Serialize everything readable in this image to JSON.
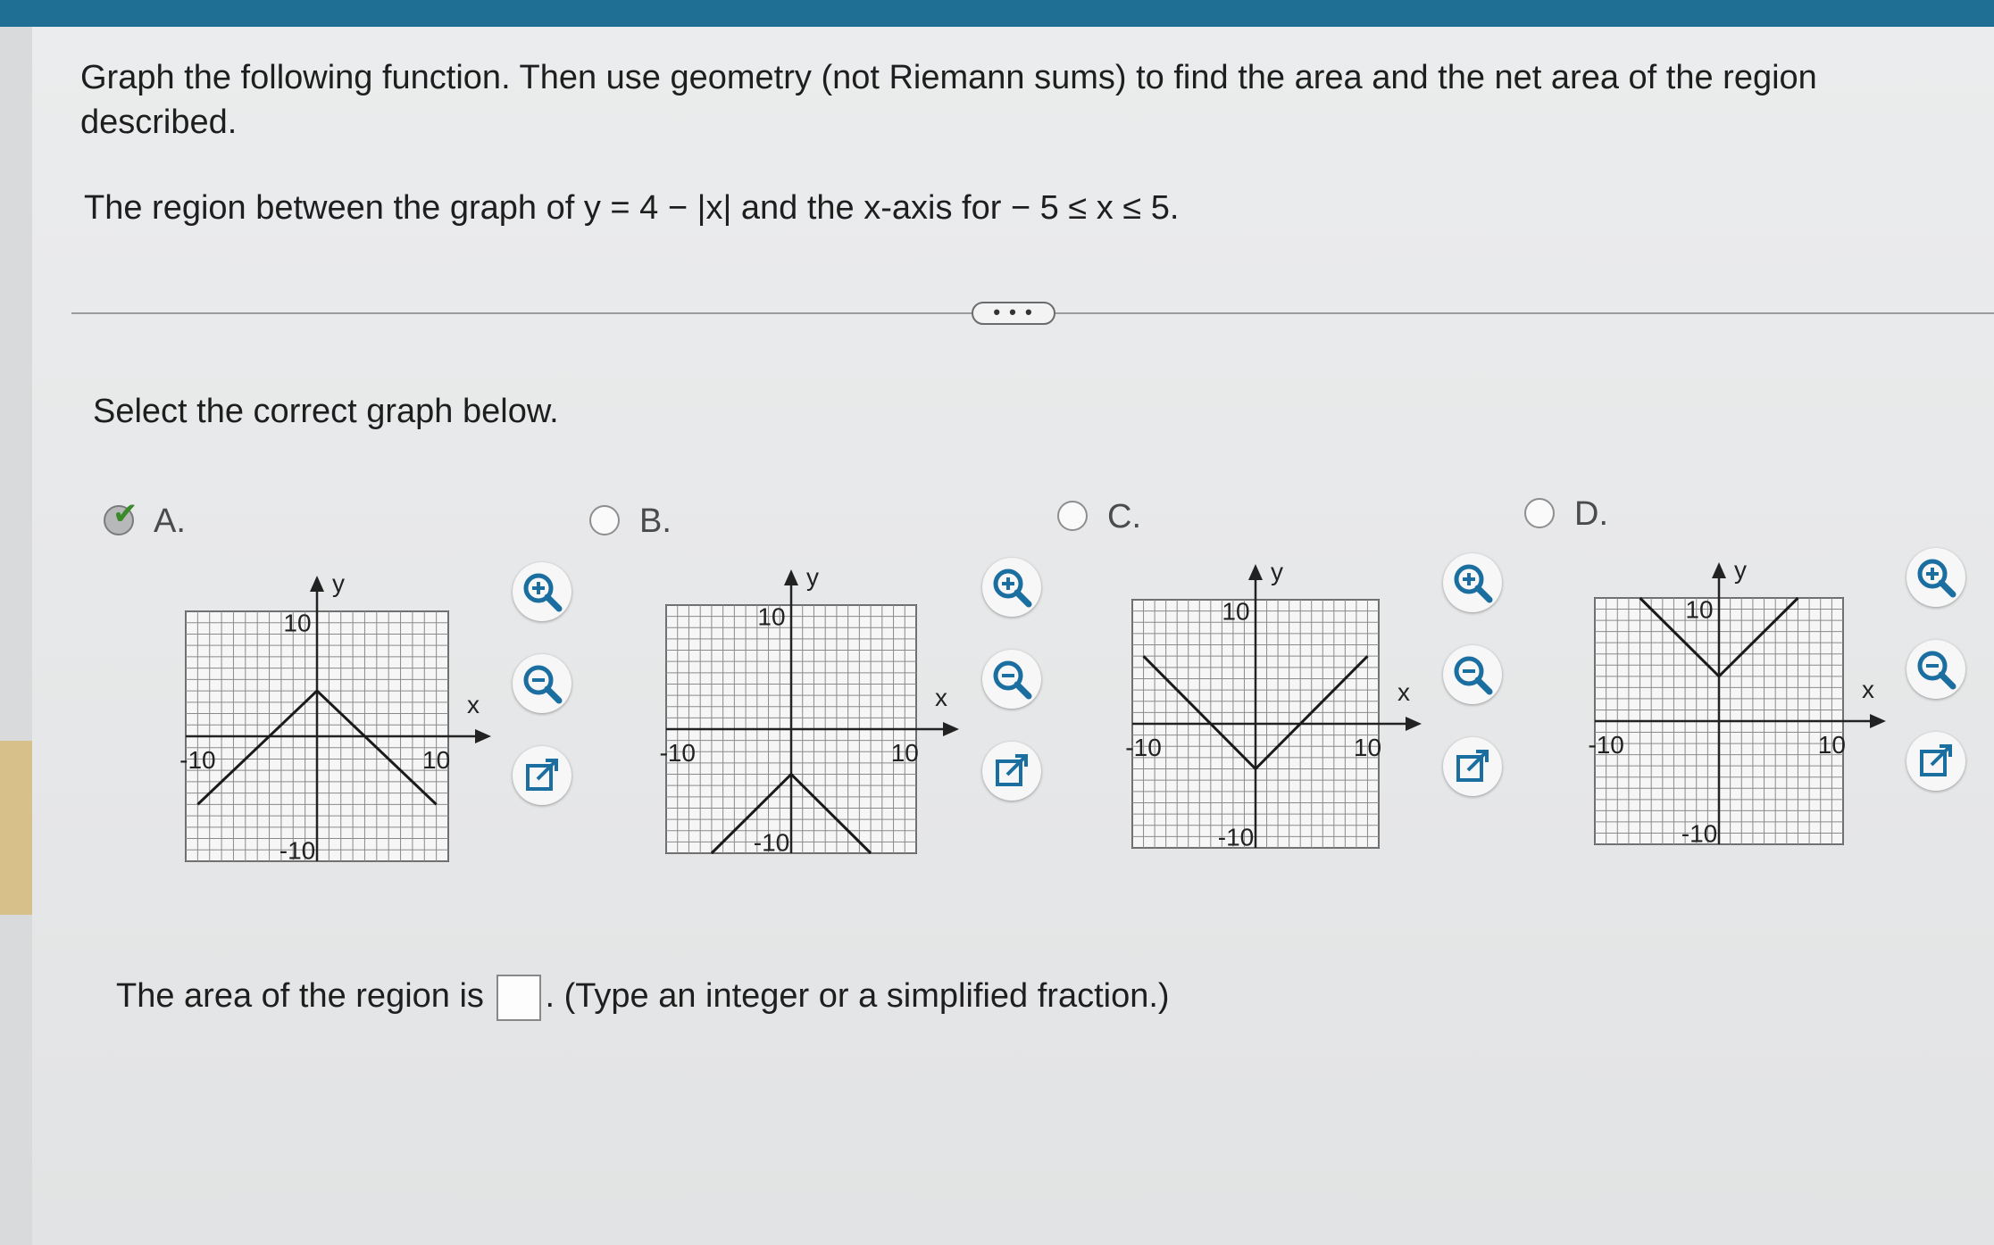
{
  "question": {
    "text": "Graph the following function. Then use geometry (not Riemann sums) to find the area and the net area of the region described.",
    "region": "The region between the graph of y = 4 − |x| and the x-axis for  − 5 ≤ x ≤ 5."
  },
  "more_button": "• • •",
  "select_prompt": "Select the correct graph below.",
  "options": [
    {
      "letter": "A.",
      "selected": true,
      "x_axis": "x",
      "y_axis": "y",
      "x_min_label": "-10",
      "x_max_label": "10",
      "y_max_label": "10",
      "y_min_label": "-10",
      "vertex": [
        0,
        4
      ],
      "shape": "inverted-v"
    },
    {
      "letter": "B.",
      "selected": false,
      "x_axis": "x",
      "y_axis": "y",
      "x_min_label": "-10",
      "x_max_label": "10",
      "y_max_label": "10",
      "y_min_label": "-10",
      "vertex": [
        0,
        -4
      ],
      "shape": "inverted-v"
    },
    {
      "letter": "C.",
      "selected": false,
      "x_axis": "x",
      "y_axis": "y",
      "x_min_label": "-10",
      "x_max_label": "10",
      "y_max_label": "10",
      "y_min_label": "-10",
      "vertex": [
        0,
        -4
      ],
      "shape": "v"
    },
    {
      "letter": "D.",
      "selected": false,
      "x_axis": "x",
      "y_axis": "y",
      "x_min_label": "-10",
      "x_max_label": "10",
      "y_max_label": "10",
      "y_min_label": "-10",
      "vertex": [
        0,
        4
      ],
      "shape": "v"
    }
  ],
  "tools": {
    "zoom_in": "zoom-in-icon",
    "zoom_out": "zoom-out-icon",
    "popout": "external-link-icon"
  },
  "answer": {
    "prefix": "The area of the region is",
    "suffix": ". (Type an integer or a simplified fraction.)",
    "value": ""
  },
  "colors": {
    "topbar": "#1f6f95",
    "check": "#3b8a2a",
    "accent": "#d8c08a"
  }
}
